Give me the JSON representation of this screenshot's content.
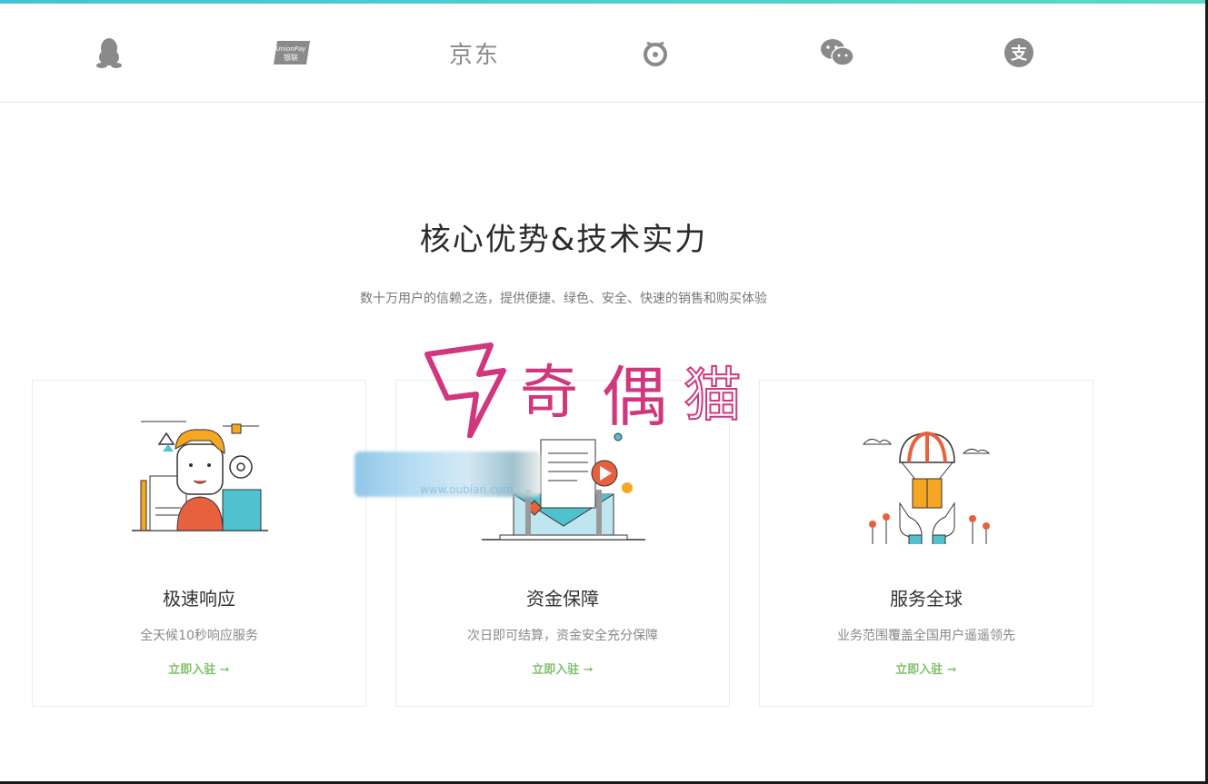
{
  "partners": [
    {
      "icon": "qq-penguin-icon"
    },
    {
      "icon": "unionpay-icon",
      "text": "UnionPay 银联"
    },
    {
      "icon": "jd-icon",
      "text": "京东"
    },
    {
      "icon": "spiral-logo-icon"
    },
    {
      "icon": "wechat-icon"
    },
    {
      "icon": "alipay-icon",
      "text": "支"
    }
  ],
  "section": {
    "title": "核心优势&技术实力",
    "subtitle": "数十万用户的信赖之选，提供便捷、绿色、安全、快速的销售和购买体验"
  },
  "cards": [
    {
      "title": "极速响应",
      "desc": "全天候10秒响应服务",
      "link": "立即入驻 ➞",
      "icon": "support-agent-illustration"
    },
    {
      "title": "资金保障",
      "desc": "次日即可结算，资金安全充分保障",
      "link": "立即入驻 ➞",
      "icon": "laptop-envelope-illustration"
    },
    {
      "title": "服务全球",
      "desc": "业务范围覆盖全国用户遥遥领先",
      "link": "立即入驻 ➞",
      "icon": "parachute-delivery-illustration"
    }
  ],
  "watermark": {
    "text": "奇偶猫",
    "url": "www.oubian.com"
  },
  "colors": {
    "accent": "#45c3d2",
    "link": "#7ec16a",
    "watermark": "#d0377f",
    "icon_gray": "#8a8a8a"
  }
}
